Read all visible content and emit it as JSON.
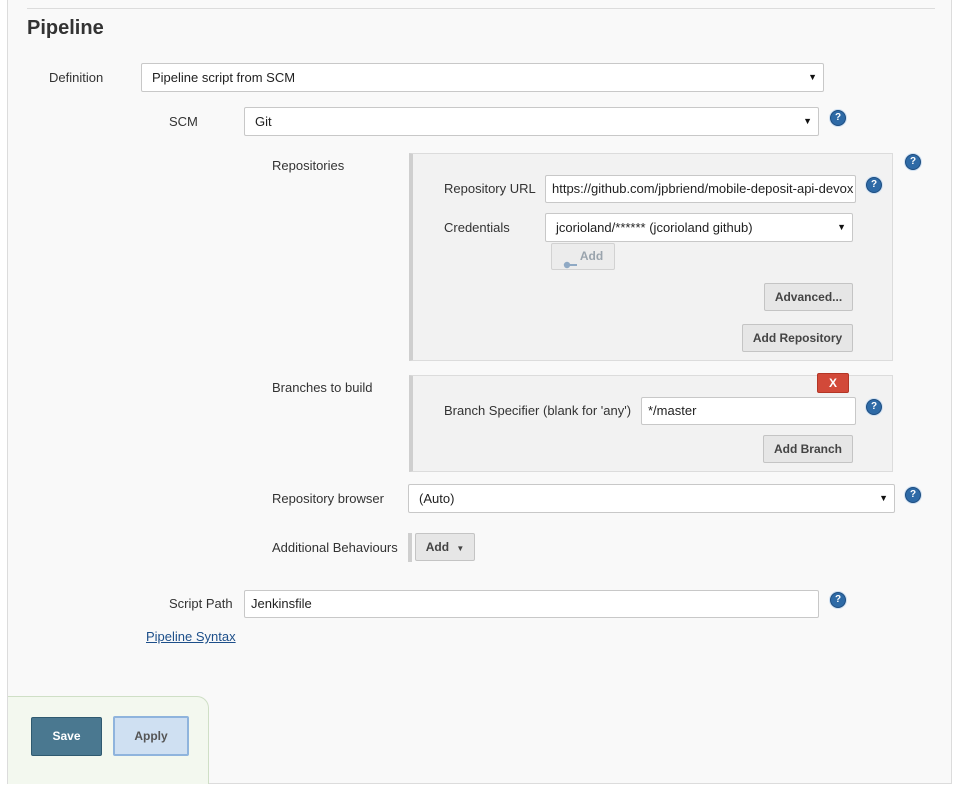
{
  "section": {
    "title": "Pipeline"
  },
  "definition": {
    "label": "Definition",
    "value": "Pipeline script from SCM"
  },
  "scm": {
    "label": "SCM",
    "value": "Git",
    "help_icon": "question-circle-icon"
  },
  "repositories": {
    "label": "Repositories",
    "url_label": "Repository URL",
    "url_value": "https://github.com/jpbriend/mobile-deposit-api-devox",
    "credentials_label": "Credentials",
    "credentials_value": "jcorioland/****** (jcorioland github)",
    "add_credentials_label": "Add",
    "advanced_label": "Advanced...",
    "add_repository_label": "Add Repository"
  },
  "branches": {
    "label": "Branches to build",
    "delete_label": "X",
    "specifier_label": "Branch Specifier (blank for 'any')",
    "specifier_value": "*/master",
    "add_branch_label": "Add Branch"
  },
  "repository_browser": {
    "label": "Repository browser",
    "value": "(Auto)"
  },
  "additional_behaviours": {
    "label": "Additional Behaviours",
    "add_label": "Add"
  },
  "script_path": {
    "label": "Script Path",
    "value": "Jenkinsfile"
  },
  "pipeline_syntax_link": "Pipeline Syntax",
  "actions": {
    "save_label": "Save",
    "apply_label": "Apply"
  },
  "colors": {
    "save_button": "#4a7890",
    "apply_button": "#cfe0f2",
    "delete_button": "#d24939",
    "help_icon": "#2e6aa6",
    "bottom_panel": "#f3f8ef"
  }
}
